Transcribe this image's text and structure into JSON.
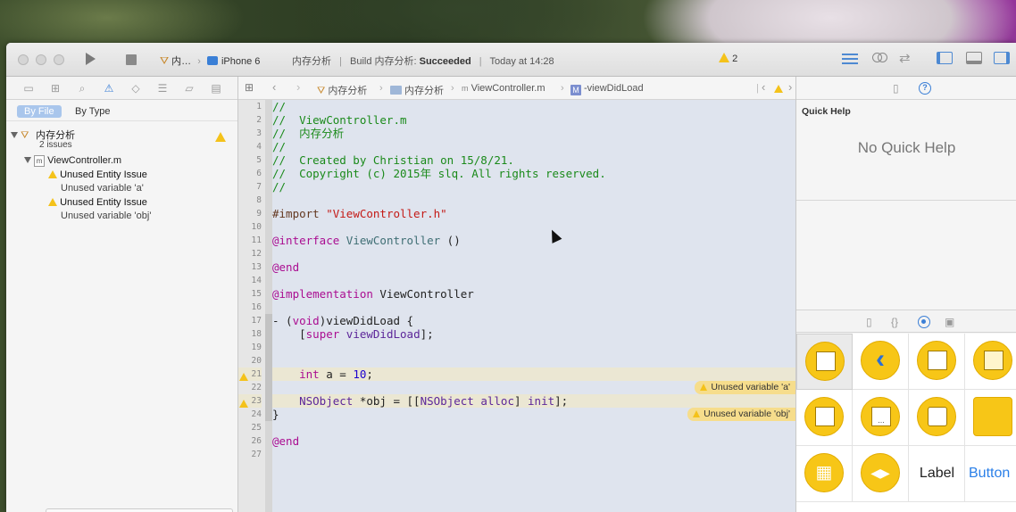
{
  "toolbar": {
    "scheme_name": "内…",
    "device": "iPhone 6",
    "activity_project": "内存分析",
    "activity_build": "Build 内存分析: ",
    "activity_status": "Succeeded",
    "activity_time": "Today at 14:28",
    "warning_count": "2"
  },
  "navigator": {
    "filter_by_file": "By File",
    "filter_by_type": "By Type",
    "project_name": "内存分析",
    "project_issue_count": "2 issues",
    "file_name": "ViewController.m",
    "issues": [
      {
        "title": "Unused Entity Issue",
        "detail": "Unused variable 'a'"
      },
      {
        "title": "Unused Entity Issue",
        "detail": "Unused variable 'obj'"
      }
    ]
  },
  "jumpbar": {
    "project": "内存分析",
    "group": "内存分析",
    "file": "ViewController.m",
    "method": "-viewDidLoad"
  },
  "code": {
    "line_numbers": [
      "1",
      "2",
      "3",
      "4",
      "5",
      "6",
      "7",
      "8",
      "9",
      "10",
      "11",
      "12",
      "13",
      "14",
      "15",
      "16",
      "17",
      "18",
      "19",
      "20",
      "21",
      "22",
      "23",
      "24",
      "25",
      "26",
      "27"
    ],
    "l1": "//",
    "l2": "//  ViewController.m",
    "l3": "//  内存分析",
    "l4": "//",
    "l5": "//  Created by Christian on 15/8/21.",
    "l6": "//  Copyright (c) 2015年 slq. All rights reserved.",
    "l7": "//",
    "l9_kw": "#import ",
    "l9_str": "\"ViewController.h\"",
    "l11_kw": "@interface",
    "l11_cls": "ViewController",
    "l11_rest": " ()",
    "l13": "@end",
    "l15_kw": "@implementation",
    "l15_rest": " ViewController",
    "l17_a": "- (",
    "l17_kw": "void",
    "l17_b": ")viewDidLoad {",
    "l18_a": "    [",
    "l18_kw": "super",
    "l18_m": " viewDidLoad",
    "l18_b": "];",
    "l21_kw": "int",
    "l21_a": " a = ",
    "l21_num": "10",
    "l21_b": ";",
    "l23_t1": "NSObject",
    "l23_a": " *obj = [[",
    "l23_t2": "NSObject",
    "l23_m1": " alloc",
    "l23_b": "] ",
    "l23_m2": "init",
    "l23_c": "];",
    "l24": "}",
    "l26": "@end",
    "warn_21": "Unused variable 'a'",
    "warn_23": "Unused variable 'obj'"
  },
  "utilities": {
    "quick_help_title": "Quick Help",
    "quick_help_empty": "No Quick Help",
    "library_label": "Label",
    "library_button": "Button"
  },
  "colors": {
    "comment": "#1a8a1a",
    "string": "#c41a16",
    "keyword": "#aa0d91",
    "warning": "#f4c21a",
    "accent": "#3b7fd6"
  }
}
